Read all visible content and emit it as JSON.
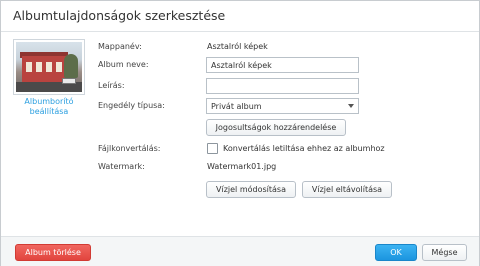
{
  "dialog": {
    "title": "Albumtulajdonságok szerkesztése"
  },
  "cover": {
    "link_label_line1": "Albumborító",
    "link_label_line2": "beállítása"
  },
  "form": {
    "folder_label": "Mappanév:",
    "folder_value": "Asztalról képek",
    "album_name_label": "Album neve:",
    "album_name_value": "Asztalról képek",
    "description_label": "Leírás:",
    "description_value": "",
    "permission_label": "Engedély típusa:",
    "permission_value": "Privát album",
    "assign_rights_button": "Jogosultságok hozzárendelése",
    "conversion_label": "Fájlkonvertálás:",
    "conversion_checkbox_label": "Konvertálás letiltása ehhez az albumhoz",
    "conversion_checked": false,
    "watermark_label": "Watermark:",
    "watermark_value": "Watermark01.jpg",
    "modify_watermark_button": "Vízjel módosítása",
    "remove_watermark_button": "Vízjel eltávolítása"
  },
  "footer": {
    "delete_button": "Album törlése",
    "ok_button": "OK",
    "cancel_button": "Mégse"
  },
  "colors": {
    "accent": "#2b9fe0",
    "danger": "#e2453e",
    "primary": "#1c95df"
  }
}
